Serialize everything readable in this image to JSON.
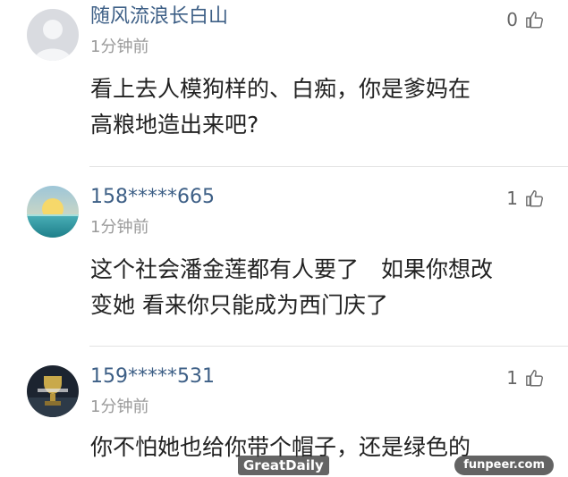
{
  "comments": [
    {
      "username": "随风流浪长白山",
      "time": "1分钟前",
      "likes": "0",
      "text": "看上去人模狗样的、白痴，你是爹妈在\n高粮地造出来吧?",
      "avatar_icon": "default-user-avatar"
    },
    {
      "username": "158*****665",
      "time": "1分钟前",
      "likes": "1",
      "text": "这个社会潘金莲都有人要了　如果你想改\n变她 看来你只能成为西门庆了",
      "avatar_icon": "sunset-sea-avatar"
    },
    {
      "username": "159*****531",
      "time": "1分钟前",
      "likes": "1",
      "text": "你不怕她也给你带个帽子，还是绿色的",
      "avatar_icon": "trophy-avatar"
    }
  ],
  "watermarks": {
    "left": "GreatDaily",
    "right": "funpeer.com"
  },
  "colors": {
    "username": "#3d5f86",
    "time": "#9a9a9a",
    "text": "#222222",
    "divider": "#e3e3e3"
  }
}
